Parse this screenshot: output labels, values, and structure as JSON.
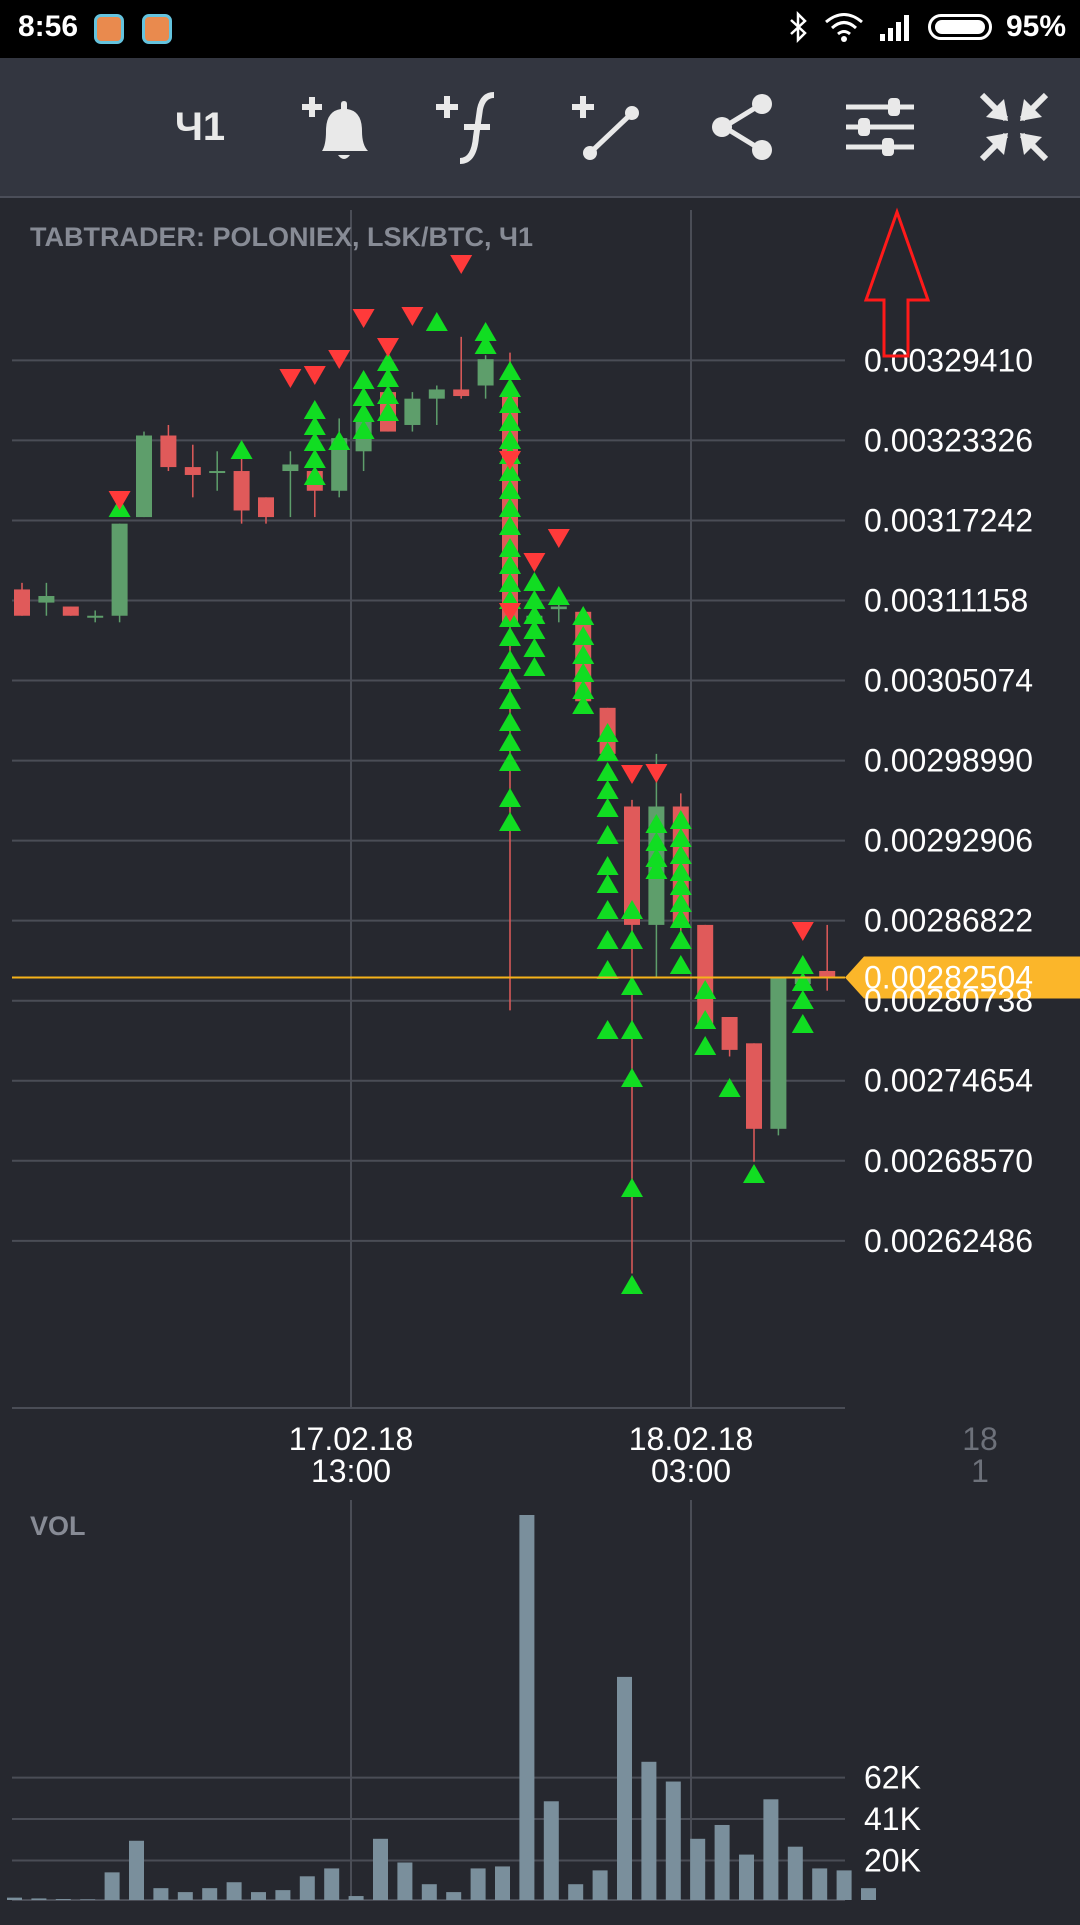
{
  "status_bar": {
    "time": "8:56",
    "battery_percent": "95%",
    "icons": [
      "app-notification-icon",
      "app-notification-icon",
      "bluetooth-icon",
      "wifi-icon",
      "signal-icon",
      "battery-icon"
    ]
  },
  "toolbar": {
    "period_label": "Ч1",
    "buttons": [
      "add-alert-icon",
      "add-indicator-icon",
      "add-drawing-icon",
      "share-icon",
      "chart-settings-icon",
      "collapse-icon"
    ]
  },
  "chart": {
    "title": "TABTRADER: POLONIEX, LSK/BTC, Ч1",
    "current_price_label": "0.00282504",
    "volume_label": "VOL",
    "price_ticks": [
      "0.00329410",
      "0.00323326",
      "0.00317242",
      "0.00311158",
      "0.00305074",
      "0.00298990",
      "0.00292906",
      "0.00286822",
      "0.00280738",
      "0.00274654",
      "0.00268570",
      "0.00262486"
    ],
    "time_ticks": [
      {
        "date": "17.02.18",
        "time": "13:00"
      },
      {
        "date": "18.02.18",
        "time": "03:00"
      },
      {
        "date": "18",
        "time": "1"
      }
    ],
    "volume_ticks": [
      "62K",
      "41K",
      "20K"
    ]
  },
  "colors": {
    "background": "#26282f",
    "toolbar": "#333640",
    "bull": "#5e9e6b",
    "bear": "#e05a5a",
    "buy_signal": "#11dd22",
    "sell_signal": "#ff3a3a",
    "price_line": "#f5b21a",
    "volume_bar": "#7a8f9c",
    "annotation": "#ff1a1a"
  },
  "chart_data": {
    "type": "candlestick",
    "symbol": "LSK/BTC",
    "exchange": "POLONIEX",
    "interval": "Ч1",
    "ylim": [
      0.00257,
      0.00334
    ],
    "current_price": 0.00282504,
    "candles": [
      {
        "o": 0.00312,
        "h": 0.003125,
        "l": 0.0031,
        "c": 0.0031
      },
      {
        "o": 0.00311,
        "h": 0.003125,
        "l": 0.0031,
        "c": 0.003115
      },
      {
        "o": 0.003107,
        "h": 0.003107,
        "l": 0.0031,
        "c": 0.0031
      },
      {
        "o": 0.0031,
        "h": 0.003104,
        "l": 0.003095,
        "c": 0.0031
      },
      {
        "o": 0.0031,
        "h": 0.00317,
        "l": 0.003095,
        "c": 0.00317
      },
      {
        "o": 0.003175,
        "h": 0.00324,
        "l": 0.003175,
        "c": 0.003237
      },
      {
        "o": 0.003237,
        "h": 0.003245,
        "l": 0.00321,
        "c": 0.003213
      },
      {
        "o": 0.003213,
        "h": 0.00323,
        "l": 0.00319,
        "c": 0.003207
      },
      {
        "o": 0.00321,
        "h": 0.003225,
        "l": 0.003195,
        "c": 0.00321
      },
      {
        "o": 0.00321,
        "h": 0.003225,
        "l": 0.00317,
        "c": 0.00318
      },
      {
        "o": 0.00319,
        "h": 0.00319,
        "l": 0.00317,
        "c": 0.003175
      },
      {
        "o": 0.00321,
        "h": 0.003225,
        "l": 0.003175,
        "c": 0.003215
      },
      {
        "o": 0.00321,
        "h": 0.00323,
        "l": 0.003175,
        "c": 0.003195
      },
      {
        "o": 0.003195,
        "h": 0.00325,
        "l": 0.00319,
        "c": 0.003235
      },
      {
        "o": 0.003225,
        "h": 0.003275,
        "l": 0.00321,
        "c": 0.00325
      },
      {
        "o": 0.00327,
        "h": 0.003285,
        "l": 0.00324,
        "c": 0.00324
      },
      {
        "o": 0.003245,
        "h": 0.00327,
        "l": 0.00324,
        "c": 0.003265
      },
      {
        "o": 0.003265,
        "h": 0.003275,
        "l": 0.003245,
        "c": 0.003272
      },
      {
        "o": 0.003272,
        "h": 0.003312,
        "l": 0.003265,
        "c": 0.003267
      },
      {
        "o": 0.003275,
        "h": 0.003298,
        "l": 0.003265,
        "c": 0.003295
      },
      {
        "o": 0.00327,
        "h": 0.0033,
        "l": 0.0028,
        "c": 0.003095
      },
      {
        "o": 0.003095,
        "h": 0.00312,
        "l": 0.003075,
        "c": 0.0031
      },
      {
        "o": 0.003105,
        "h": 0.00311,
        "l": 0.003095,
        "c": 0.003107
      },
      {
        "o": 0.003103,
        "h": 0.003103,
        "l": 0.003035,
        "c": 0.003035
      },
      {
        "o": 0.00303,
        "h": 0.00303,
        "l": 0.002995,
        "c": 0.002995
      },
      {
        "o": 0.002955,
        "h": 0.00296,
        "l": 0.0026,
        "c": 0.002865
      },
      {
        "o": 0.002865,
        "h": 0.002995,
        "l": 0.002825,
        "c": 0.002955
      },
      {
        "o": 0.002955,
        "h": 0.002965,
        "l": 0.002855,
        "c": 0.002865
      },
      {
        "o": 0.002865,
        "h": 0.002865,
        "l": 0.00279,
        "c": 0.00279
      },
      {
        "o": 0.002795,
        "h": 0.002795,
        "l": 0.002765,
        "c": 0.00277
      },
      {
        "o": 0.002775,
        "h": 0.002775,
        "l": 0.002685,
        "c": 0.00271
      },
      {
        "o": 0.00271,
        "h": 0.00282,
        "l": 0.002705,
        "c": 0.002825
      },
      {
        "o": 0.00282,
        "h": 0.00283,
        "l": 0.002815,
        "c": 0.002825
      },
      {
        "o": 0.00283,
        "h": 0.002865,
        "l": 0.002815,
        "c": 0.002825
      }
    ],
    "volume": [
      1200,
      800,
      500,
      300,
      14000,
      30000,
      6000,
      4000,
      6000,
      9000,
      4000,
      5000,
      12000,
      16000,
      2000,
      31000,
      19000,
      8000,
      4000,
      16000,
      17000,
      195000,
      50000,
      8000,
      15000,
      113000,
      70000,
      60000,
      31000,
      38000,
      23000,
      51000,
      27000,
      16000,
      15000,
      6000
    ],
    "volume_ylim": [
      0,
      195000
    ]
  }
}
